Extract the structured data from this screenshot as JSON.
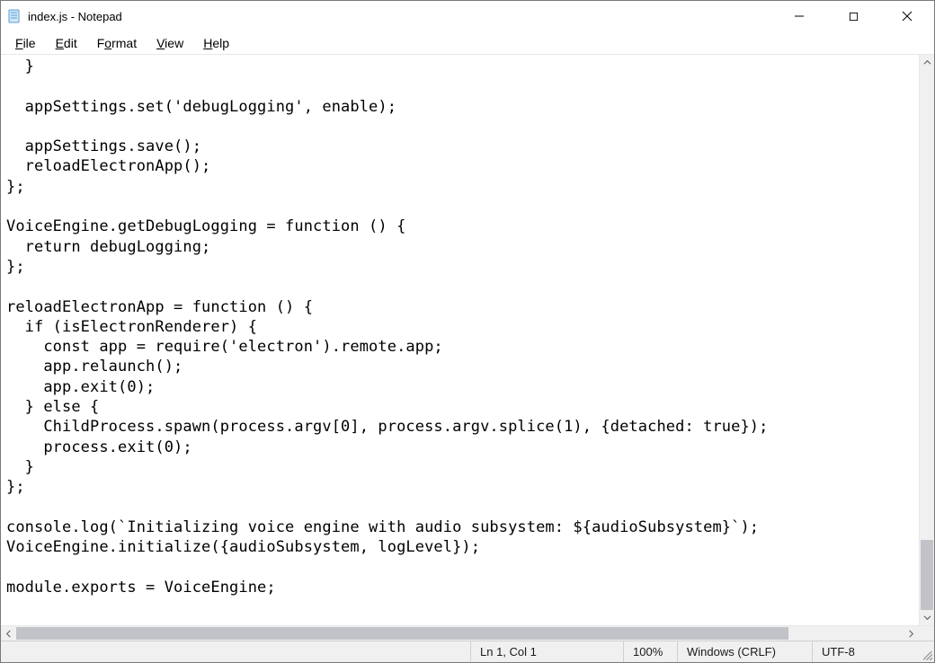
{
  "title": "index.js - Notepad",
  "menu": {
    "file": "File",
    "edit": "Edit",
    "format": "Format",
    "view": "View",
    "help": "Help"
  },
  "editor_text": "  }\n\n  appSettings.set('debugLogging', enable);\n\n  appSettings.save();\n  reloadElectronApp();\n};\n\nVoiceEngine.getDebugLogging = function () {\n  return debugLogging;\n};\n\nreloadElectronApp = function () {\n  if (isElectronRenderer) {\n    const app = require('electron').remote.app;\n    app.relaunch();\n    app.exit(0);\n  } else {\n    ChildProcess.spawn(process.argv[0], process.argv.splice(1), {detached: true});\n    process.exit(0);\n  }\n};\n\nconsole.log(`Initializing voice engine with audio subsystem: ${audioSubsystem}`);\nVoiceEngine.initialize({audioSubsystem, logLevel});\n\nmodule.exports = VoiceEngine;",
  "status": {
    "position": "Ln 1, Col 1",
    "zoom": "100%",
    "eol": "Windows (CRLF)",
    "encoding": "UTF-8"
  },
  "scroll": {
    "v_thumb_top_pct": 87,
    "v_thumb_height_pct": 13,
    "h_thumb_left_pct": 0,
    "h_thumb_width_pct": 87
  }
}
